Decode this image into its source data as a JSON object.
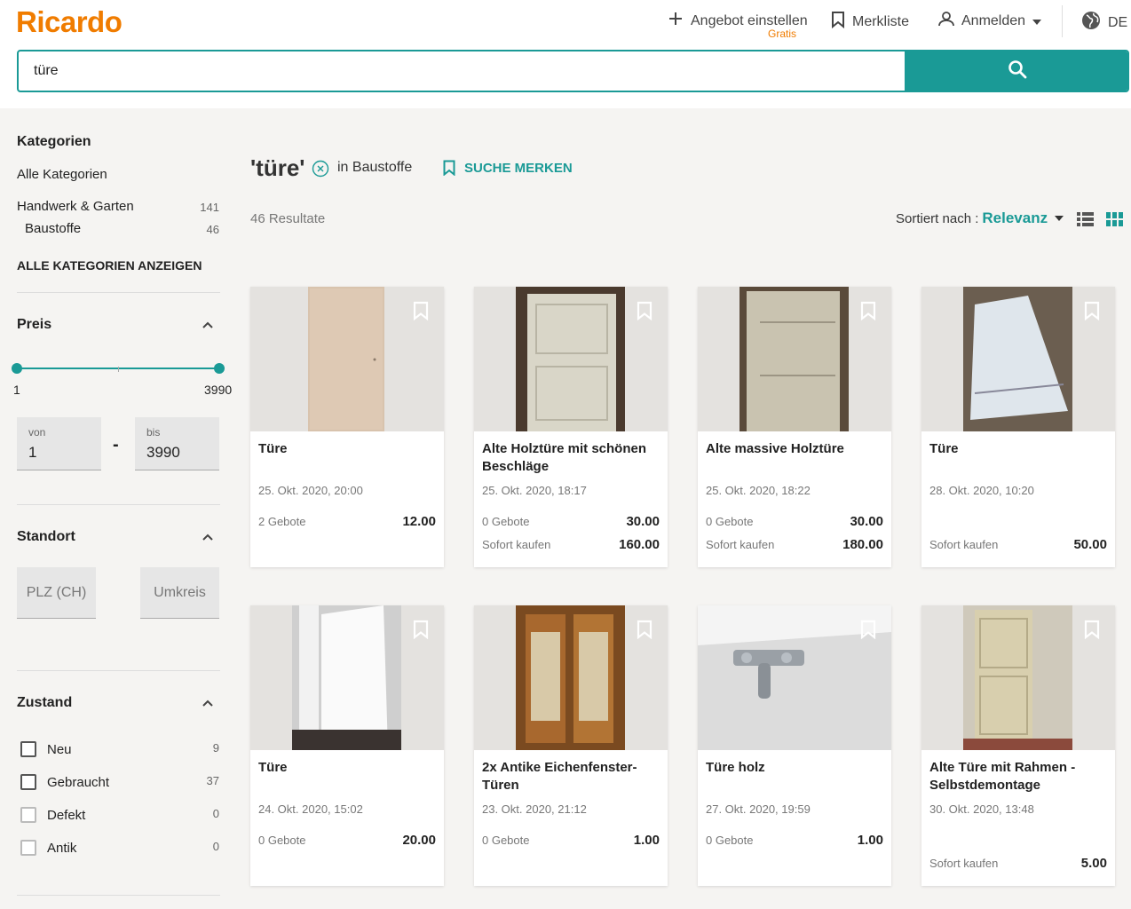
{
  "header": {
    "logo": "Ricardo",
    "offer_label": "Angebot einstellen",
    "offer_sub": "Gratis",
    "watchlist_label": "Merkliste",
    "login_label": "Anmelden",
    "lang_label": "DE",
    "search_value": "türe",
    "colors": {
      "brand": "#f07c00",
      "accent": "#1a9a96"
    }
  },
  "sidebar": {
    "categories_title": "Kategorien",
    "all_categories": "Alle Kategorien",
    "category_items": [
      {
        "label": "Handwerk & Garten",
        "count": "141"
      },
      {
        "label": "Baustoffe",
        "count": "46"
      }
    ],
    "show_all": "ALLE KATEGORIEN ANZEIGEN",
    "price_title": "Preis",
    "price_min_label": "1",
    "price_max_label": "3990",
    "from_label": "von",
    "from_value": "1",
    "range_dash": "-",
    "to_label": "bis",
    "to_value": "3990",
    "location_title": "Standort",
    "plz_label": "PLZ (CH)",
    "radius_label": "Umkreis",
    "condition_title": "Zustand",
    "conditions": [
      {
        "label": "Neu",
        "count": "9"
      },
      {
        "label": "Gebraucht",
        "count": "37"
      },
      {
        "label": "Defekt",
        "count": "0"
      },
      {
        "label": "Antik",
        "count": "0"
      }
    ]
  },
  "main": {
    "query": "'türe'",
    "in_category": "in Baustoffe",
    "save_search": "SUCHE MERKEN",
    "results": "46 Resultate",
    "sort_label": "Sortiert nach :",
    "sort_value": "Relevanz"
  },
  "listings": [
    {
      "title": "Türe",
      "date": "25. Okt. 2020, 20:00",
      "bids_label": "2 Gebote",
      "bid_price": "12.00",
      "buy_label": "",
      "buy_price": ""
    },
    {
      "title": "Alte Holztüre mit schönen Beschläge",
      "date": "25. Okt. 2020, 18:17",
      "bids_label": "0 Gebote",
      "bid_price": "30.00",
      "buy_label": "Sofort kaufen",
      "buy_price": "160.00"
    },
    {
      "title": "Alte massive Holztüre",
      "date": "25. Okt. 2020, 18:22",
      "bids_label": "0 Gebote",
      "bid_price": "30.00",
      "buy_label": "Sofort kaufen",
      "buy_price": "180.00"
    },
    {
      "title": "Türe",
      "date": "28. Okt. 2020, 10:20",
      "bids_label": "",
      "bid_price": "",
      "buy_label": "Sofort kaufen",
      "buy_price": "50.00"
    },
    {
      "title": "Türe",
      "date": "24. Okt. 2020, 15:02",
      "bids_label": "0 Gebote",
      "bid_price": "20.00",
      "buy_label": "",
      "buy_price": ""
    },
    {
      "title": "2x Antike Eichenfenster-Türen",
      "date": "23. Okt. 2020, 21:12",
      "bids_label": "0 Gebote",
      "bid_price": "1.00",
      "buy_label": "",
      "buy_price": ""
    },
    {
      "title": "Türe holz",
      "date": "27. Okt. 2020, 19:59",
      "bids_label": "0 Gebote",
      "bid_price": "1.00",
      "buy_label": "",
      "buy_price": ""
    },
    {
      "title": "Alte Türe mit Rahmen - Selbstdemontage",
      "date": "30. Okt. 2020, 13:48",
      "bids_label": "",
      "bid_price": "",
      "buy_label": "Sofort kaufen",
      "buy_price": "5.00"
    }
  ]
}
